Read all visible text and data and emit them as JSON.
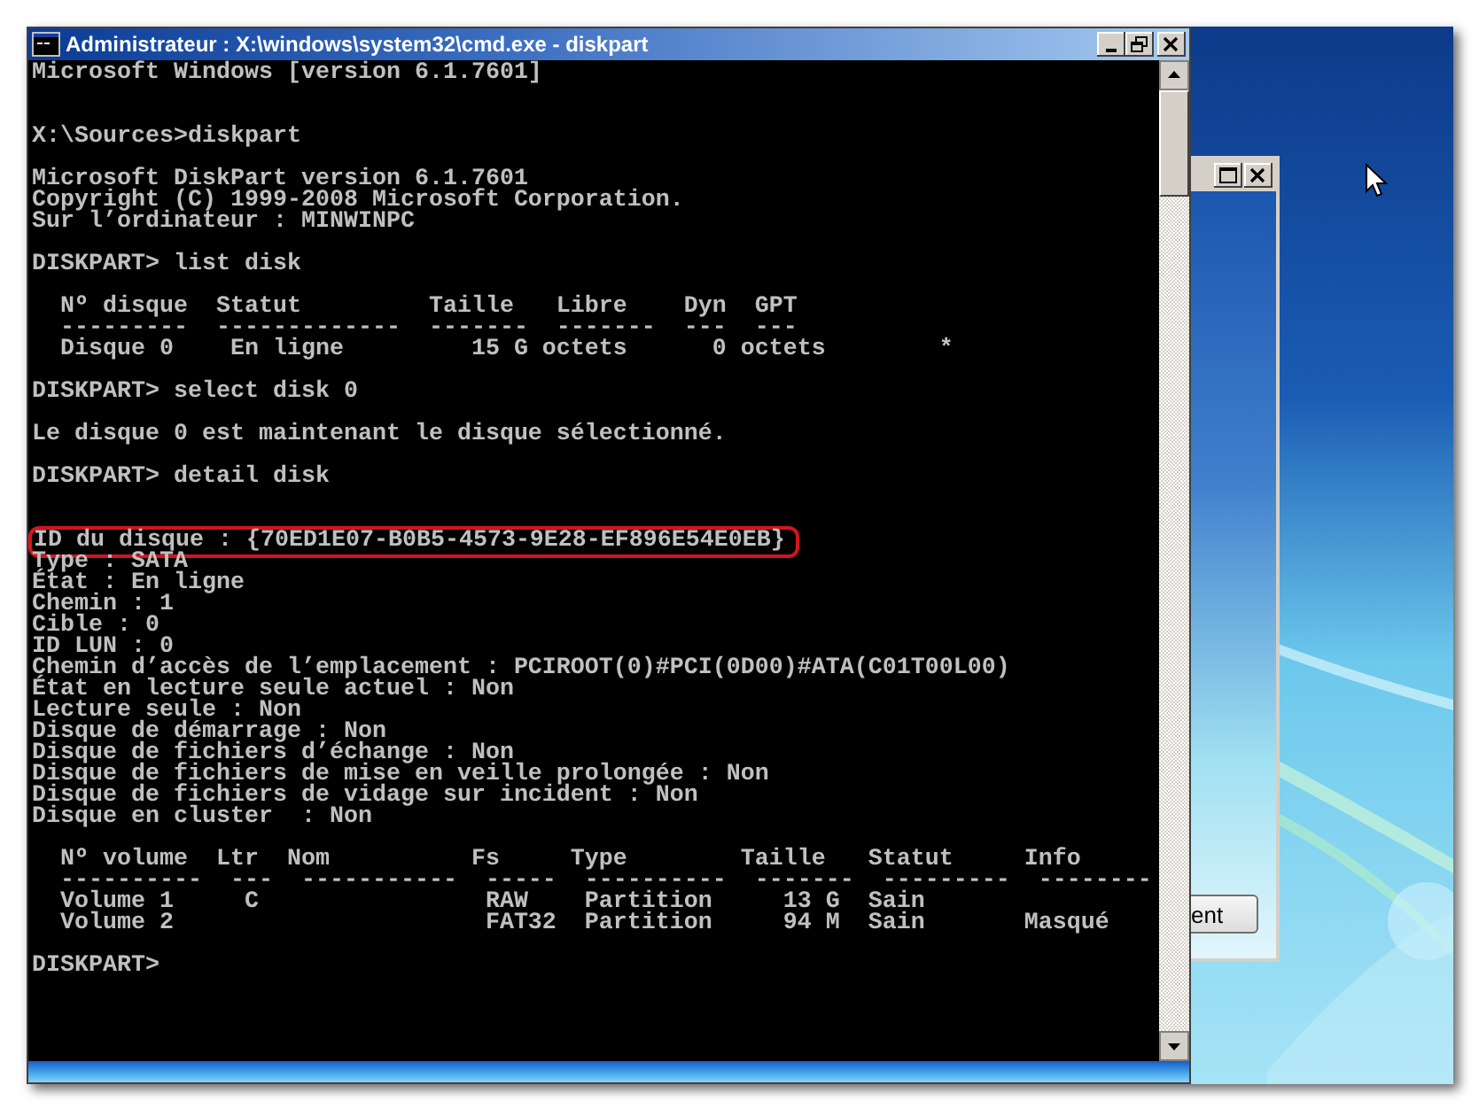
{
  "window": {
    "title": "Administrateur : X:\\windows\\system32\\cmd.exe - diskpart"
  },
  "console": {
    "lines": [
      {
        "kind": "text",
        "text": "Microsoft Windows [version 6.1.7601]"
      },
      {
        "kind": "blank"
      },
      {
        "kind": "blank"
      },
      {
        "kind": "text",
        "text": "X:\\Sources>diskpart"
      },
      {
        "kind": "blank"
      },
      {
        "kind": "text",
        "text": "Microsoft DiskPart version 6.1.7601"
      },
      {
        "kind": "text",
        "text": "Copyright (C) 1999-2008 Microsoft Corporation."
      },
      {
        "kind": "text",
        "text": "Sur l’ordinateur : MINWINPC"
      },
      {
        "kind": "blank"
      },
      {
        "kind": "text",
        "text": "DISKPART> list disk"
      },
      {
        "kind": "blank"
      },
      {
        "kind": "text",
        "text": "  Nº disque  Statut         Taille   Libre    Dyn  GPT"
      },
      {
        "kind": "text",
        "text": "  ---------  -------------  -------  -------  ---  ---"
      },
      {
        "kind": "text",
        "text": "  Disque 0    En ligne         15 G octets      0 octets        *"
      },
      {
        "kind": "blank"
      },
      {
        "kind": "text",
        "text": "DISKPART> select disk 0"
      },
      {
        "kind": "blank"
      },
      {
        "kind": "text",
        "text": "Le disque 0 est maintenant le disque sélectionné."
      },
      {
        "kind": "blank"
      },
      {
        "kind": "text",
        "text": "DISKPART> detail disk"
      },
      {
        "kind": "blank"
      },
      {
        "kind": "blank"
      },
      {
        "kind": "highlighted",
        "text": "ID du disque : {70ED1E07-B0B5-4573-9E28-EF896E54E0EB}"
      },
      {
        "kind": "text",
        "text": "Type : SATA"
      },
      {
        "kind": "text",
        "text": "État : En ligne"
      },
      {
        "kind": "text",
        "text": "Chemin : 1"
      },
      {
        "kind": "text",
        "text": "Cible : 0"
      },
      {
        "kind": "text",
        "text": "ID LUN : 0"
      },
      {
        "kind": "text",
        "text": "Chemin d’accès de l’emplacement : PCIROOT(0)#PCI(0D00)#ATA(C01T00L00)"
      },
      {
        "kind": "text",
        "text": "État en lecture seule actuel : Non"
      },
      {
        "kind": "text",
        "text": "Lecture seule : Non"
      },
      {
        "kind": "text",
        "text": "Disque de démarrage : Non"
      },
      {
        "kind": "text",
        "text": "Disque de fichiers d’échange : Non"
      },
      {
        "kind": "text",
        "text": "Disque de fichiers de mise en veille prolongée : Non"
      },
      {
        "kind": "text",
        "text": "Disque de fichiers de vidage sur incident : Non"
      },
      {
        "kind": "text",
        "text": "Disque en cluster  : Non"
      },
      {
        "kind": "blank"
      },
      {
        "kind": "text",
        "text": "  Nº volume  Ltr  Nom          Fs     Type        Taille   Statut     Info"
      },
      {
        "kind": "text",
        "text": "  ----------  ---  -----------  -----  ----------  -------  ---------  --------"
      },
      {
        "kind": "text",
        "text": "  Volume 1     C                RAW    Partition     13 G  Sain"
      },
      {
        "kind": "text",
        "text": "  Volume 2                      FAT32  Partition     94 M  Sain       Masqué"
      },
      {
        "kind": "blank"
      },
      {
        "kind": "text",
        "text": "DISKPART>"
      }
    ]
  },
  "background_window": {
    "button": "ent"
  }
}
